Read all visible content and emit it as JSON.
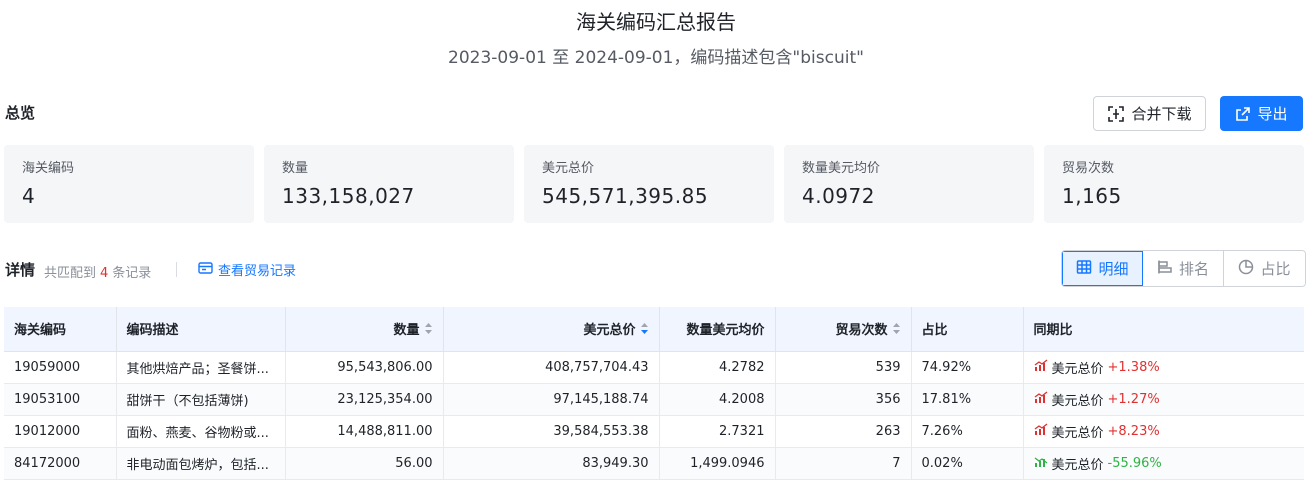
{
  "header": {
    "title": "海关编码汇总报告",
    "subtitle": "2023-09-01 至 2024-09-01，编码描述包含\"biscuit\""
  },
  "overview": {
    "label": "总览",
    "merge_download_label": "合并下载",
    "export_label": "导出"
  },
  "stats": [
    {
      "label": "海关编码",
      "value": "4"
    },
    {
      "label": "数量",
      "value": "133,158,027"
    },
    {
      "label": "美元总价",
      "value": "545,571,395.85"
    },
    {
      "label": "数量美元均价",
      "value": "4.0972"
    },
    {
      "label": "贸易次数",
      "value": "1,165"
    }
  ],
  "details": {
    "label": "详情",
    "match_prefix": "共匹配到",
    "match_count": "4",
    "match_suffix": "条记录",
    "trade_link": "查看贸易记录"
  },
  "view_toggle": {
    "detail": "明细",
    "rank": "排名",
    "share": "占比",
    "active": "detail"
  },
  "table": {
    "columns": [
      "海关编码",
      "编码描述",
      "数量",
      "美元总价",
      "数量美元均价",
      "贸易次数",
      "占比",
      "同期比"
    ],
    "rows": [
      {
        "code": "19059000",
        "desc": "其他烘焙产品；圣餐饼...",
        "qty": "95,543,806.00",
        "usd": "408,757,704.43",
        "avg": "4.2782",
        "trades": "539",
        "share": "74.92%",
        "yoy_label": "美元总价",
        "yoy": "+1.38%",
        "trend": "up"
      },
      {
        "code": "19053100",
        "desc": "甜饼干（不包括薄饼)",
        "qty": "23,125,354.00",
        "usd": "97,145,188.74",
        "avg": "4.2008",
        "trades": "356",
        "share": "17.81%",
        "yoy_label": "美元总价",
        "yoy": "+1.27%",
        "trend": "up"
      },
      {
        "code": "19012000",
        "desc": "面粉、燕麦、谷物粉或...",
        "qty": "14,488,811.00",
        "usd": "39,584,553.38",
        "avg": "2.7321",
        "trades": "263",
        "share": "7.26%",
        "yoy_label": "美元总价",
        "yoy": "+8.23%",
        "trend": "up"
      },
      {
        "code": "84172000",
        "desc": "非电动面包烤炉，包括...",
        "qty": "56.00",
        "usd": "83,949.30",
        "avg": "1,499.0946",
        "trades": "7",
        "share": "0.02%",
        "yoy_label": "美元总价",
        "yoy": "-55.96%",
        "trend": "down"
      }
    ]
  },
  "colors": {
    "accent": "#1677ff",
    "up": "#e03131",
    "down": "#2fb344",
    "header_bg": "#f0f5ff",
    "card_bg": "#f5f6f8"
  }
}
